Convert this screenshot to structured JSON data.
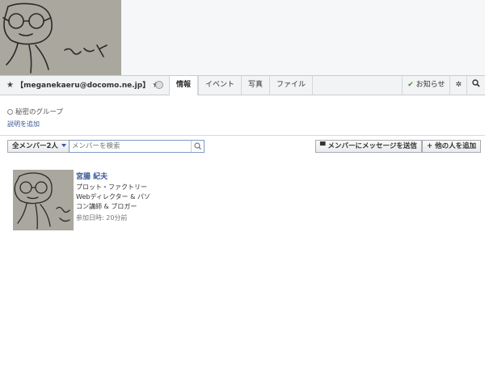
{
  "group": {
    "title": "【meganekaeru@docomo.ne.jp】"
  },
  "tabs": [
    {
      "label": "情報"
    },
    {
      "label": "イベント"
    },
    {
      "label": "写真"
    },
    {
      "label": "ファイル"
    }
  ],
  "actions": {
    "notifications": "お知らせ"
  },
  "info": {
    "privacy": "秘密のグループ",
    "add_description": "説明を追加"
  },
  "members": {
    "filter_label": "全メンバー2人",
    "search_placeholder": "メンバーを検索",
    "send_message": "メンバーにメッセージを送信",
    "add_people": "他の人を追加",
    "list": [
      {
        "name": "宮腸 紀夫",
        "bio": "プロット・ファクトリー Webディレクター & パソコン講師 & ブロガー",
        "joined": "参加日時: 20分前"
      }
    ]
  },
  "colors": {
    "link": "#3b5998",
    "header_bg": "#f2f3f5"
  }
}
